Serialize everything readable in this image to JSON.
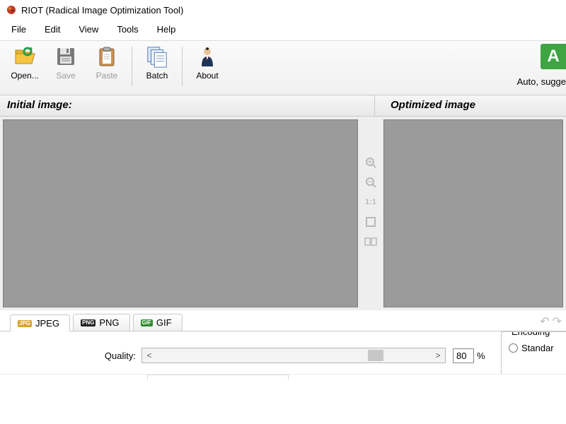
{
  "title": "RIOT (Radical Image Optimization Tool)",
  "menu": {
    "file": "File",
    "edit": "Edit",
    "view": "View",
    "tools": "Tools",
    "help": "Help"
  },
  "toolbar": {
    "open": "Open...",
    "save": "Save",
    "paste": "Paste",
    "batch": "Batch",
    "about": "About",
    "auto_badge": "A",
    "auto_text": "Auto, sugge"
  },
  "panes": {
    "initial": "Initial image:",
    "optimized": "Optimized image"
  },
  "zoom": {
    "one_to_one": "1:1"
  },
  "tabs": {
    "jpeg_badge": "JPG",
    "jpeg": "JPEG",
    "png_badge": "PNG",
    "png": "PNG",
    "gif_badge": "GIF",
    "gif": "GIF"
  },
  "quality": {
    "label": "Quality:",
    "value": "80",
    "pct": "%"
  },
  "encoding": {
    "legend": "Encoding",
    "standard": "Standar"
  }
}
